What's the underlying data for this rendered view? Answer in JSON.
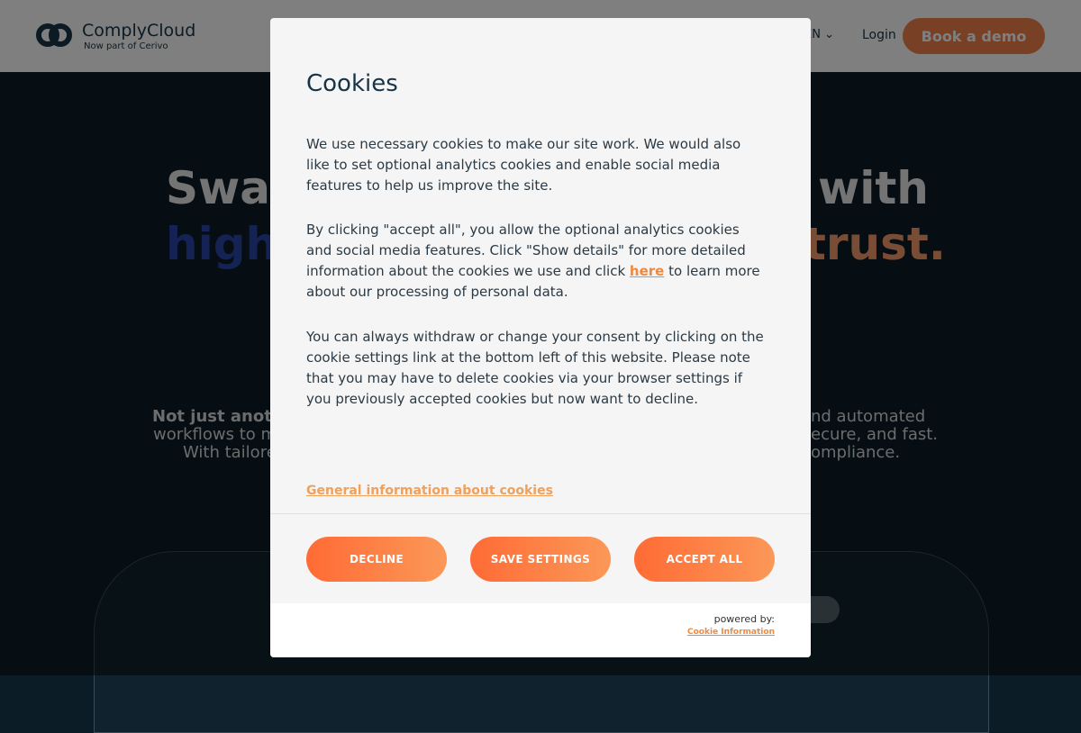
{
  "header": {
    "logo_name": "ComplyCloud",
    "logo_sub": "Now part of Cerivo",
    "lang": "EN ⌄",
    "login": "Login",
    "demo_button": "Book a demo"
  },
  "hero": {
    "line1_left": "Swap",
    "line1_right": "with",
    "line2_left": "high",
    "line2_right": "trust.",
    "para_left": [
      "Not just anoth",
      "workflows to m",
      "With tailore"
    ],
    "para_right": [
      "nd automated",
      "ecure, and fast.",
      "ompliance."
    ]
  },
  "modal": {
    "title": "Cookies",
    "para1": "We use necessary cookies to make our site work. We would also like to set optional analytics cookies and enable social media features to help us improve the site.",
    "para2_before": "By clicking \"accept all\", you allow the optional analytics cookies and social media features. Click \"Show details\" for more detailed information about the cookies we use and click ",
    "para2_link": "here",
    "para2_after": " to learn more about our processing of personal data.",
    "para3": "You can always withdraw or change your consent by clicking on the cookie settings link at the bottom left of this website. Please note that you may have to delete cookies via your browser settings if you previously accepted cookies but now want to decline.",
    "general_link": "General information about cookies",
    "buttons": {
      "decline": "DECLINE",
      "save": "SAVE SETTINGS",
      "accept": "ACCEPT ALL"
    },
    "powered_by": "powered by:",
    "powered_link": "Cookie Information"
  },
  "colors": {
    "accent_orange": "#ff6b35",
    "navy": "#173447",
    "hero_bg": "#0c1c26"
  }
}
